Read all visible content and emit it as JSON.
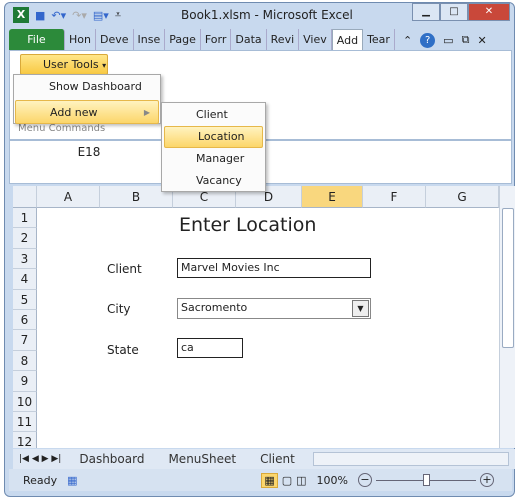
{
  "window": {
    "title": "Book1.xlsm  -  Microsoft Excel"
  },
  "ribbon_tabs": [
    "File",
    "Hon",
    "Deve",
    "Inse",
    "Page",
    "Forr",
    "Data",
    "Revi",
    "Viev",
    "Add",
    "Tear"
  ],
  "active_tab": "Add",
  "user_tools": {
    "label": "User Tools",
    "group_label": "Menu Commands",
    "items": [
      "Show Dashboard",
      "Add new"
    ],
    "submenu": [
      "Client",
      "Location",
      "Manager",
      "Vacancy"
    ],
    "highlighted": "Location"
  },
  "name_box": "E18",
  "columns": [
    "A",
    "B",
    "C",
    "D",
    "E",
    "F",
    "G"
  ],
  "selected_column": "E",
  "rows": [
    "1",
    "2",
    "3",
    "4",
    "5",
    "6",
    "7",
    "8",
    "9",
    "10",
    "11",
    "12"
  ],
  "form": {
    "heading": "Enter Location",
    "client_label": "Client",
    "client_value": "Marvel Movies Inc",
    "city_label": "City",
    "city_value": "Sacromento",
    "state_label": "State",
    "state_value": "ca"
  },
  "sheet_tabs": [
    "Dashboard",
    "MenuSheet",
    "Client"
  ],
  "status": {
    "ready": "Ready",
    "zoom": "100%"
  },
  "zoom_level_percent": 100
}
